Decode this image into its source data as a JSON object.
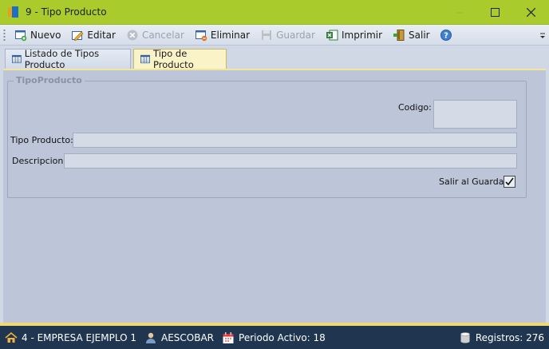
{
  "window": {
    "title": "9 - Tipo Producto"
  },
  "toolbar": {
    "items": [
      {
        "label": "Nuevo",
        "icon": "new-document-icon",
        "enabled": true
      },
      {
        "label": "Editar",
        "icon": "edit-pencil-icon",
        "enabled": true
      },
      {
        "label": "Cancelar",
        "icon": "cancel-x-icon",
        "enabled": false
      },
      {
        "label": "Eliminar",
        "icon": "delete-document-icon",
        "enabled": true
      },
      {
        "label": "Guardar",
        "icon": "save-disk-icon",
        "enabled": false
      },
      {
        "label": "Imprimir",
        "icon": "excel-print-icon",
        "enabled": true
      },
      {
        "label": "Salir",
        "icon": "exit-door-icon",
        "enabled": true
      }
    ],
    "help_icon": "help-icon"
  },
  "tabs": [
    {
      "label": "Listado de Tipos Producto",
      "active": false
    },
    {
      "label": "Tipo de Producto",
      "active": true
    }
  ],
  "form": {
    "group_title": "TipoProducto",
    "codigo_label": "Codigo:",
    "codigo_value": "",
    "tipo_producto_label": "Tipo Producto:",
    "tipo_producto_value": "",
    "descripcion_label": "Descripcion:",
    "descripcion_value": "",
    "salir_label": "Salir al Guardar",
    "salir_checked": true
  },
  "statusbar": {
    "empresa": "4 - EMPRESA EJEMPLO 1",
    "usuario": "AESCOBAR",
    "periodo": "Periodo Activo: 18",
    "registros": "Registros: 276"
  },
  "colors": {
    "titlebar": "#a9cc2c",
    "statusbar": "#1f3550",
    "active_tab": "#fbf3c8",
    "content_bg": "#bcc6d8"
  }
}
